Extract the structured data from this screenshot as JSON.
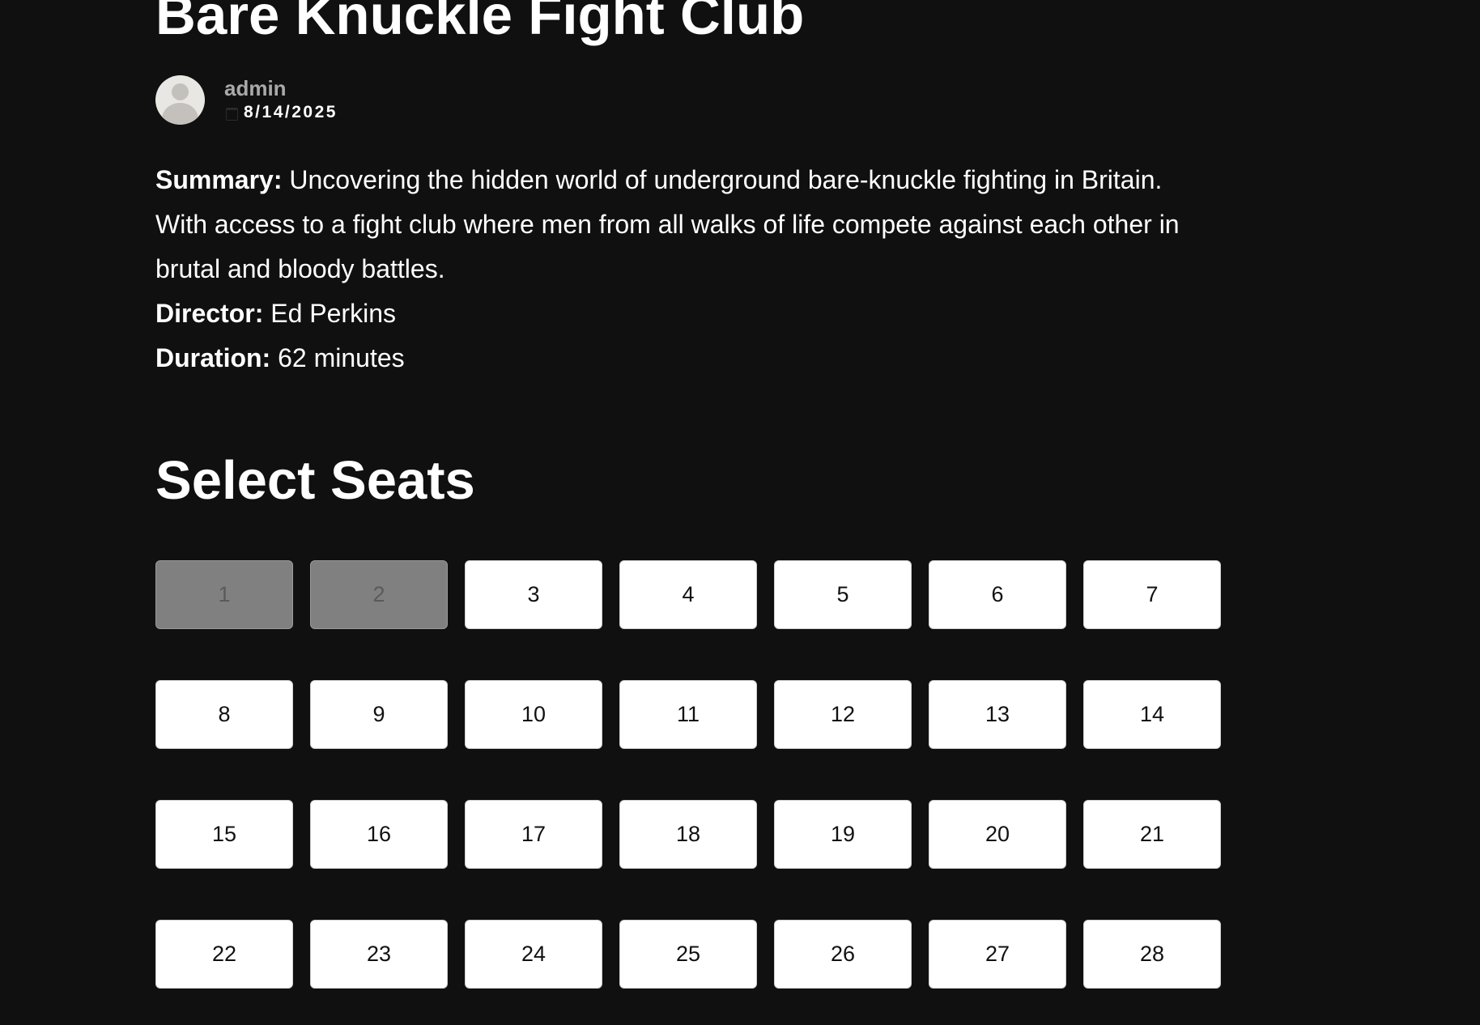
{
  "movie": {
    "title": "Bare Knuckle Fight Club",
    "author": "admin",
    "date": "8/14/2025",
    "summary_label": "Summary:",
    "summary": "Uncovering the hidden world of underground bare-knuckle fighting in Britain. With access to a fight club where men from all walks of life compete against each other in brutal and bloody battles.",
    "director_label": "Director:",
    "director": "Ed Perkins",
    "duration_label": "Duration:",
    "duration": "62 minutes"
  },
  "seats": {
    "heading": "Select Seats",
    "items": [
      {
        "label": "1",
        "status": "taken"
      },
      {
        "label": "2",
        "status": "taken"
      },
      {
        "label": "3",
        "status": "available"
      },
      {
        "label": "4",
        "status": "available"
      },
      {
        "label": "5",
        "status": "available"
      },
      {
        "label": "6",
        "status": "available"
      },
      {
        "label": "7",
        "status": "available"
      },
      {
        "label": "8",
        "status": "available"
      },
      {
        "label": "9",
        "status": "available"
      },
      {
        "label": "10",
        "status": "available"
      },
      {
        "label": "11",
        "status": "available"
      },
      {
        "label": "12",
        "status": "available"
      },
      {
        "label": "13",
        "status": "available"
      },
      {
        "label": "14",
        "status": "available"
      },
      {
        "label": "15",
        "status": "available"
      },
      {
        "label": "16",
        "status": "available"
      },
      {
        "label": "17",
        "status": "available"
      },
      {
        "label": "18",
        "status": "available"
      },
      {
        "label": "19",
        "status": "available"
      },
      {
        "label": "20",
        "status": "available"
      },
      {
        "label": "21",
        "status": "available"
      },
      {
        "label": "22",
        "status": "available"
      },
      {
        "label": "23",
        "status": "available"
      },
      {
        "label": "24",
        "status": "available"
      },
      {
        "label": "25",
        "status": "available"
      },
      {
        "label": "26",
        "status": "available"
      },
      {
        "label": "27",
        "status": "available"
      },
      {
        "label": "28",
        "status": "available"
      }
    ]
  },
  "icons": {
    "avatar": "user-avatar-icon",
    "date": "calendar-icon"
  },
  "colors": {
    "background": "#101010",
    "seat_available": "#ffffff",
    "seat_taken": "#808080",
    "author_name": "#a9a9a9"
  }
}
